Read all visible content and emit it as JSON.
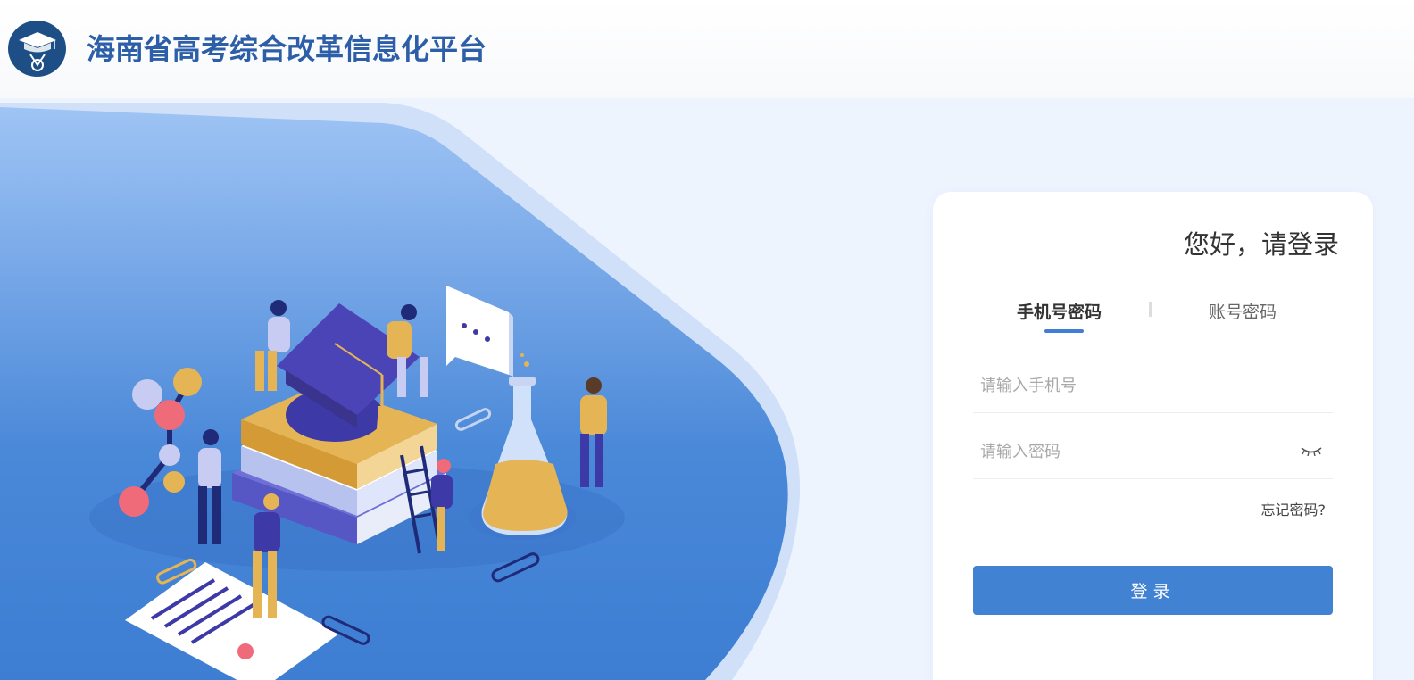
{
  "header": {
    "site_title": "海南省高考综合改革信息化平台",
    "logo_icon": "graduation-cap-medal-logo"
  },
  "login": {
    "greeting": "您好，请登录",
    "tabs": [
      {
        "label": "手机号密码",
        "active": true
      },
      {
        "label": "账号密码",
        "active": false
      }
    ],
    "phone_placeholder": "请输入手机号",
    "password_placeholder": "请输入密码",
    "password_toggle_icon": "eye-closed-icon",
    "forgot_label": "忘记密码?",
    "submit_label": "登录"
  },
  "colors": {
    "brand_blue": "#2d5ea8",
    "button_blue": "#4282d3",
    "page_background": "#eef4fe",
    "hero_blue": "#4282d3"
  }
}
